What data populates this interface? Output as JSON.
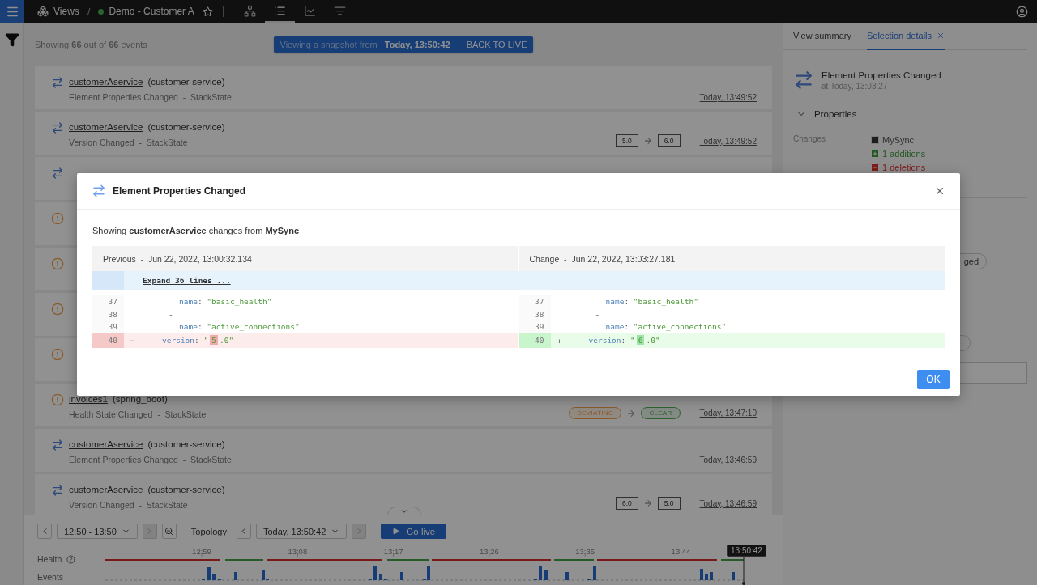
{
  "topbar": {
    "views_label": "Views",
    "separator": "/",
    "view_name": "Demo - Customer A",
    "view_buttons": [
      {
        "selected": false
      },
      {
        "selected": true
      },
      {
        "selected": false
      },
      {
        "selected": false
      }
    ]
  },
  "events_header": {
    "summary": "Showing **66** out of **66** events",
    "banner_text": "Viewing a snapshot from",
    "banner_time": "Today, 13:50:42",
    "banner_button": "BACK TO LIVE"
  },
  "events": [
    {
      "kind": "change",
      "name": "customerAservice",
      "type": "(customer-service)",
      "subtitle": "Element Properties Changed  -  StackState",
      "time": "Today, 13:49:52"
    },
    {
      "kind": "change",
      "name": "customerAservice",
      "type": "(customer-service)",
      "subtitle": "Version Changed  -  StackState",
      "transition": {
        "kind": "version",
        "from": {
          "label": "5.0"
        },
        "to": {
          "label": "6.0"
        }
      },
      "time": "Today, 13:49:52"
    },
    {
      "kind": "change"
    },
    {
      "kind": "health"
    },
    {
      "kind": "health"
    },
    {
      "kind": "health"
    },
    {
      "kind": "health"
    },
    {
      "kind": "health",
      "name": "invoices1",
      "type": "(spring_boot)",
      "subtitle": "Health State Changed  -  StackState",
      "transition": {
        "kind": "health",
        "from": {
          "label": "DEVIATING",
          "kind": "warning"
        },
        "to": {
          "label": "CLEAR",
          "kind": "ok"
        }
      },
      "time": "Today, 13:47:10"
    },
    {
      "kind": "change",
      "name": "customerAservice",
      "type": "(customer-service)",
      "subtitle": "Element Properties Changed  -  StackState",
      "time": "Today, 13:46:59"
    },
    {
      "kind": "change",
      "name": "customerAservice",
      "type": "(customer-service)",
      "subtitle": "Version Changed  -  StackState",
      "transition": {
        "kind": "version",
        "from": {
          "label": "6.0"
        },
        "to": {
          "label": "5.0"
        }
      },
      "time": "Today, 13:46:59"
    }
  ],
  "timeline": {
    "range": "12:50 - 13:50",
    "next_range_disabled": true,
    "topology_label": "Topology",
    "topology_time": "Today, 13:50:42",
    "next_topology_disabled": true,
    "go_live": "Go live",
    "health_label": "Health",
    "events_label": "Events",
    "ticks": [
      "12:59",
      "13:08",
      "13:17",
      "13:26",
      "13:35",
      "13:44"
    ],
    "cursor_label": "13:50:42"
  },
  "side_panel": {
    "tabs": [
      {
        "label": "View summary",
        "selected": false
      },
      {
        "label": "Selection details",
        "selected": true
      }
    ],
    "title": "Element Properties Changed",
    "subtitle": "at Today, 13:03:27",
    "section": {
      "label": "Properties",
      "expanded": true
    },
    "changes_label": "Changes",
    "source": "MySync",
    "additions": "1 additions",
    "deletions": "1 deletions",
    "chips": [
      {
        "label": "ged"
      }
    ]
  },
  "dialog": {
    "title": "Element Properties Changed",
    "summary": "Showing **customerAservice** changes from **MySync**",
    "columns": [
      {
        "label": "Previous  -  Jun 22, 2022, 13:00:32.134"
      },
      {
        "label": "Change  -  Jun 22, 2022, 13:03:27.181"
      }
    ],
    "expand": "Expand 36 lines ...",
    "left_lines": [
      {
        "number": "37",
        "removed": false,
        "added": false,
        "kind": "nested",
        "parts": [
          {
            "kind": "key",
            "text": "name"
          },
          {
            "kind": "plain",
            "text": ": "
          },
          {
            "kind": "string",
            "text": "\"basic_health\""
          }
        ]
      },
      {
        "number": "38",
        "removed": false,
        "added": false,
        "kind": "item",
        "parts": [
          {
            "kind": "plain",
            "text": "-"
          }
        ]
      },
      {
        "number": "39",
        "removed": false,
        "added": false,
        "kind": "nested",
        "parts": [
          {
            "kind": "key",
            "text": "name"
          },
          {
            "kind": "plain",
            "text": ": "
          },
          {
            "kind": "string",
            "text": "\"active_connections\""
          }
        ]
      },
      {
        "number": "40",
        "removed": true,
        "added": false,
        "marker": "−",
        "kind": "field",
        "parts": [
          {
            "kind": "key",
            "text": "version"
          },
          {
            "kind": "plain",
            "text": ": "
          },
          {
            "kind": "string",
            "text": "\""
          },
          {
            "kind": "string",
            "text": "5",
            "highlight": true
          },
          {
            "kind": "string",
            "text": ".0\""
          }
        ]
      }
    ],
    "right_lines": [
      {
        "number": "37",
        "removed": false,
        "added": false,
        "kind": "nested",
        "parts": [
          {
            "kind": "key",
            "text": "name"
          },
          {
            "kind": "plain",
            "text": ": "
          },
          {
            "kind": "string",
            "text": "\"basic_health\""
          }
        ]
      },
      {
        "number": "38",
        "removed": false,
        "added": false,
        "kind": "item",
        "parts": [
          {
            "kind": "plain",
            "text": "-"
          }
        ]
      },
      {
        "number": "39",
        "removed": false,
        "added": false,
        "kind": "nested",
        "parts": [
          {
            "kind": "key",
            "text": "name"
          },
          {
            "kind": "plain",
            "text": ": "
          },
          {
            "kind": "string",
            "text": "\"active_connections\""
          }
        ]
      },
      {
        "number": "40",
        "removed": false,
        "added": true,
        "marker": "+",
        "kind": "field",
        "parts": [
          {
            "kind": "key",
            "text": "version"
          },
          {
            "kind": "plain",
            "text": ": "
          },
          {
            "kind": "string",
            "text": "\""
          },
          {
            "kind": "string",
            "text": "6",
            "highlight": true
          },
          {
            "kind": "string",
            "text": ".0\""
          }
        ]
      }
    ],
    "ok": "OK"
  }
}
